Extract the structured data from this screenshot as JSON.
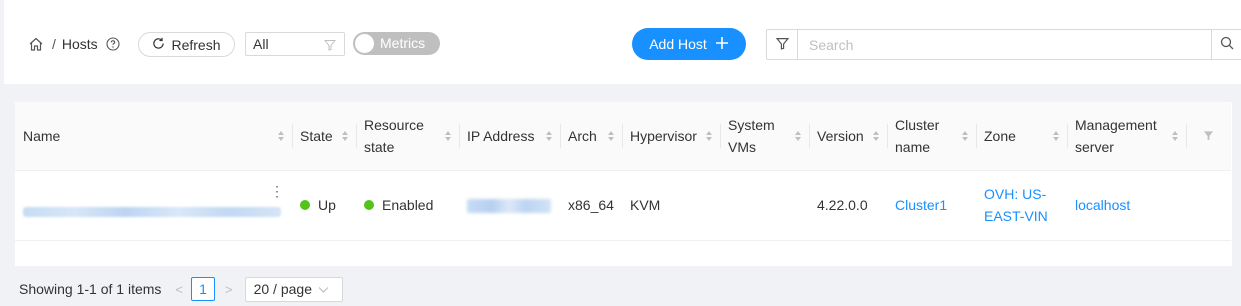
{
  "breadcrumb": {
    "page": "Hosts"
  },
  "toolbar": {
    "refresh_label": "Refresh",
    "filter_value": "All",
    "metrics_label": "Metrics",
    "metrics_on": false,
    "add_label": "Add Host",
    "search_placeholder": "Search"
  },
  "table": {
    "columns": [
      "Name",
      "State",
      "Resource state",
      "IP Address",
      "Arch",
      "Hypervisor",
      "System VMs",
      "Version",
      "Cluster name",
      "Zone",
      "Management server"
    ],
    "rows": [
      {
        "state": "Up",
        "resource_state": "Enabled",
        "arch": "x86_64",
        "hypervisor": "KVM",
        "version": "4.22.0.0",
        "cluster": "Cluster1",
        "zone": "OVH: US-EAST-VIN",
        "management_server": "localhost"
      }
    ]
  },
  "pagination": {
    "summary": "Showing 1-1 of 1 items",
    "current_page": "1",
    "page_size": "20 / page"
  },
  "colors": {
    "accent": "#1890ff",
    "status_up": "#52c41a"
  }
}
